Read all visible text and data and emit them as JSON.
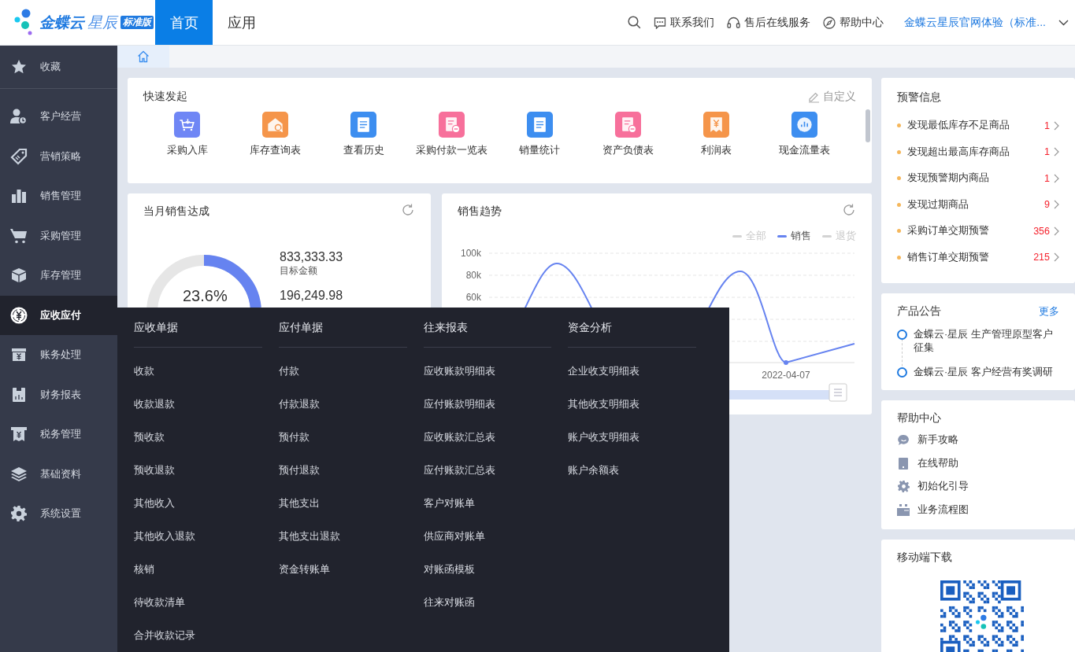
{
  "header": {
    "logo_brand": "金蝶云",
    "logo_product": "星辰",
    "edition_badge": "标准版",
    "nav_tabs": [
      {
        "label": "首页",
        "selected": true
      },
      {
        "label": "应用",
        "selected": false
      }
    ],
    "links": [
      {
        "kind": "chat",
        "label": "联系我们"
      },
      {
        "kind": "headset",
        "label": "售后在线服务"
      },
      {
        "kind": "compass",
        "label": "帮助中心"
      }
    ],
    "account": "金蝶云星辰官网体验（标准..."
  },
  "sidebar": {
    "items": [
      {
        "kind": "star",
        "label": "收藏",
        "selected": false
      },
      {
        "kind": "customer",
        "label": "客户经营",
        "selected": false
      },
      {
        "kind": "tag",
        "label": "营销策略",
        "selected": false
      },
      {
        "kind": "bars",
        "label": "销售管理",
        "selected": false
      },
      {
        "kind": "cart",
        "label": "采购管理",
        "selected": false
      },
      {
        "kind": "box",
        "label": "库存管理",
        "selected": false
      },
      {
        "kind": "yuan-circle",
        "label": "应收应付",
        "selected": true
      },
      {
        "kind": "yuan-box",
        "label": "账务处理",
        "selected": false
      },
      {
        "kind": "report",
        "label": "财务报表",
        "selected": false
      },
      {
        "kind": "receipt",
        "label": "税务管理",
        "selected": false
      },
      {
        "kind": "layers",
        "label": "基础资料",
        "selected": false
      },
      {
        "kind": "gear",
        "label": "系统设置",
        "selected": false
      }
    ]
  },
  "quick_start": {
    "title": "快速发起",
    "customize": "自定义",
    "items": [
      {
        "kind": "cart",
        "label": "采购入库",
        "color": "#6f86f5"
      },
      {
        "kind": "house",
        "label": "库存查询表",
        "color": "#f5954a"
      },
      {
        "kind": "doc",
        "label": "查看历史",
        "color": "#3d8ef0"
      },
      {
        "kind": "doc-minus",
        "label": "采购付款一览表",
        "color": "#f7709b"
      },
      {
        "kind": "doc",
        "label": "销量统计",
        "color": "#3d8ef0"
      },
      {
        "kind": "doc-minus",
        "label": "资产负债表",
        "color": "#f7709b"
      },
      {
        "kind": "yuan",
        "label": "利润表",
        "color": "#f5954a"
      },
      {
        "kind": "chart",
        "label": "现金流量表",
        "color": "#3d8ef0"
      }
    ]
  },
  "sales_target": {
    "title": "当月销售达成",
    "level": 0.236,
    "percent": "23.6%",
    "target_amount": "833,333.33",
    "target_label": "目标金额",
    "achieved_amount": "196,249.98"
  },
  "sales_trend": {
    "title": "销售趋势",
    "legend": [
      {
        "label": "全部",
        "selected": false
      },
      {
        "label": "销售",
        "selected": true
      },
      {
        "label": "退货",
        "selected": false
      }
    ],
    "y_ticks": [
      "100k",
      "80k",
      "60k"
    ],
    "x_label": "2022-04-07"
  },
  "warnings": {
    "title": "预警信息",
    "items": [
      {
        "label": "发现最低库存不足商品",
        "count": "1"
      },
      {
        "label": "发现超出最高库存商品",
        "count": "1"
      },
      {
        "label": "发现预警期内商品",
        "count": "1"
      },
      {
        "label": "发现过期商品",
        "count": "9"
      },
      {
        "label": "采购订单交期预警",
        "count": "356"
      },
      {
        "label": "销售订单交期预警",
        "count": "215"
      }
    ]
  },
  "announcements": {
    "title": "产品公告",
    "more": "更多",
    "items": [
      "金蝶云·星辰 生产管理原型客户征集",
      "金蝶云·星辰 客户经营有奖调研"
    ]
  },
  "help_center": {
    "title": "帮助中心",
    "items": [
      {
        "kind": "chat",
        "label": "新手攻略"
      },
      {
        "kind": "book",
        "label": "在线帮助"
      },
      {
        "kind": "gear",
        "label": "初始化引导"
      },
      {
        "kind": "calendar",
        "label": "业务流程图"
      }
    ]
  },
  "mobile_download": {
    "title": "移动端下载"
  },
  "mega_menu": {
    "columns": [
      {
        "title": "应收单据",
        "items": [
          "收款",
          "收款退款",
          "预收款",
          "预收退款",
          "其他收入",
          "其他收入退款",
          "核销",
          "待收款清单",
          "合并收款记录"
        ]
      },
      {
        "title": "应付单据",
        "items": [
          "付款",
          "付款退款",
          "预付款",
          "预付退款",
          "其他支出",
          "其他支出退款",
          "资金转账单"
        ]
      },
      {
        "title": "往来报表",
        "items": [
          "应收账款明细表",
          "应付账款明细表",
          "应收账款汇总表",
          "应付账款汇总表",
          "客户对账单",
          "供应商对账单",
          "对账函模板",
          "往来对账函"
        ]
      },
      {
        "title": "资金分析",
        "items": [
          "企业收支明细表",
          "其他收支明细表",
          "账户收支明细表",
          "账户余额表"
        ]
      }
    ]
  }
}
